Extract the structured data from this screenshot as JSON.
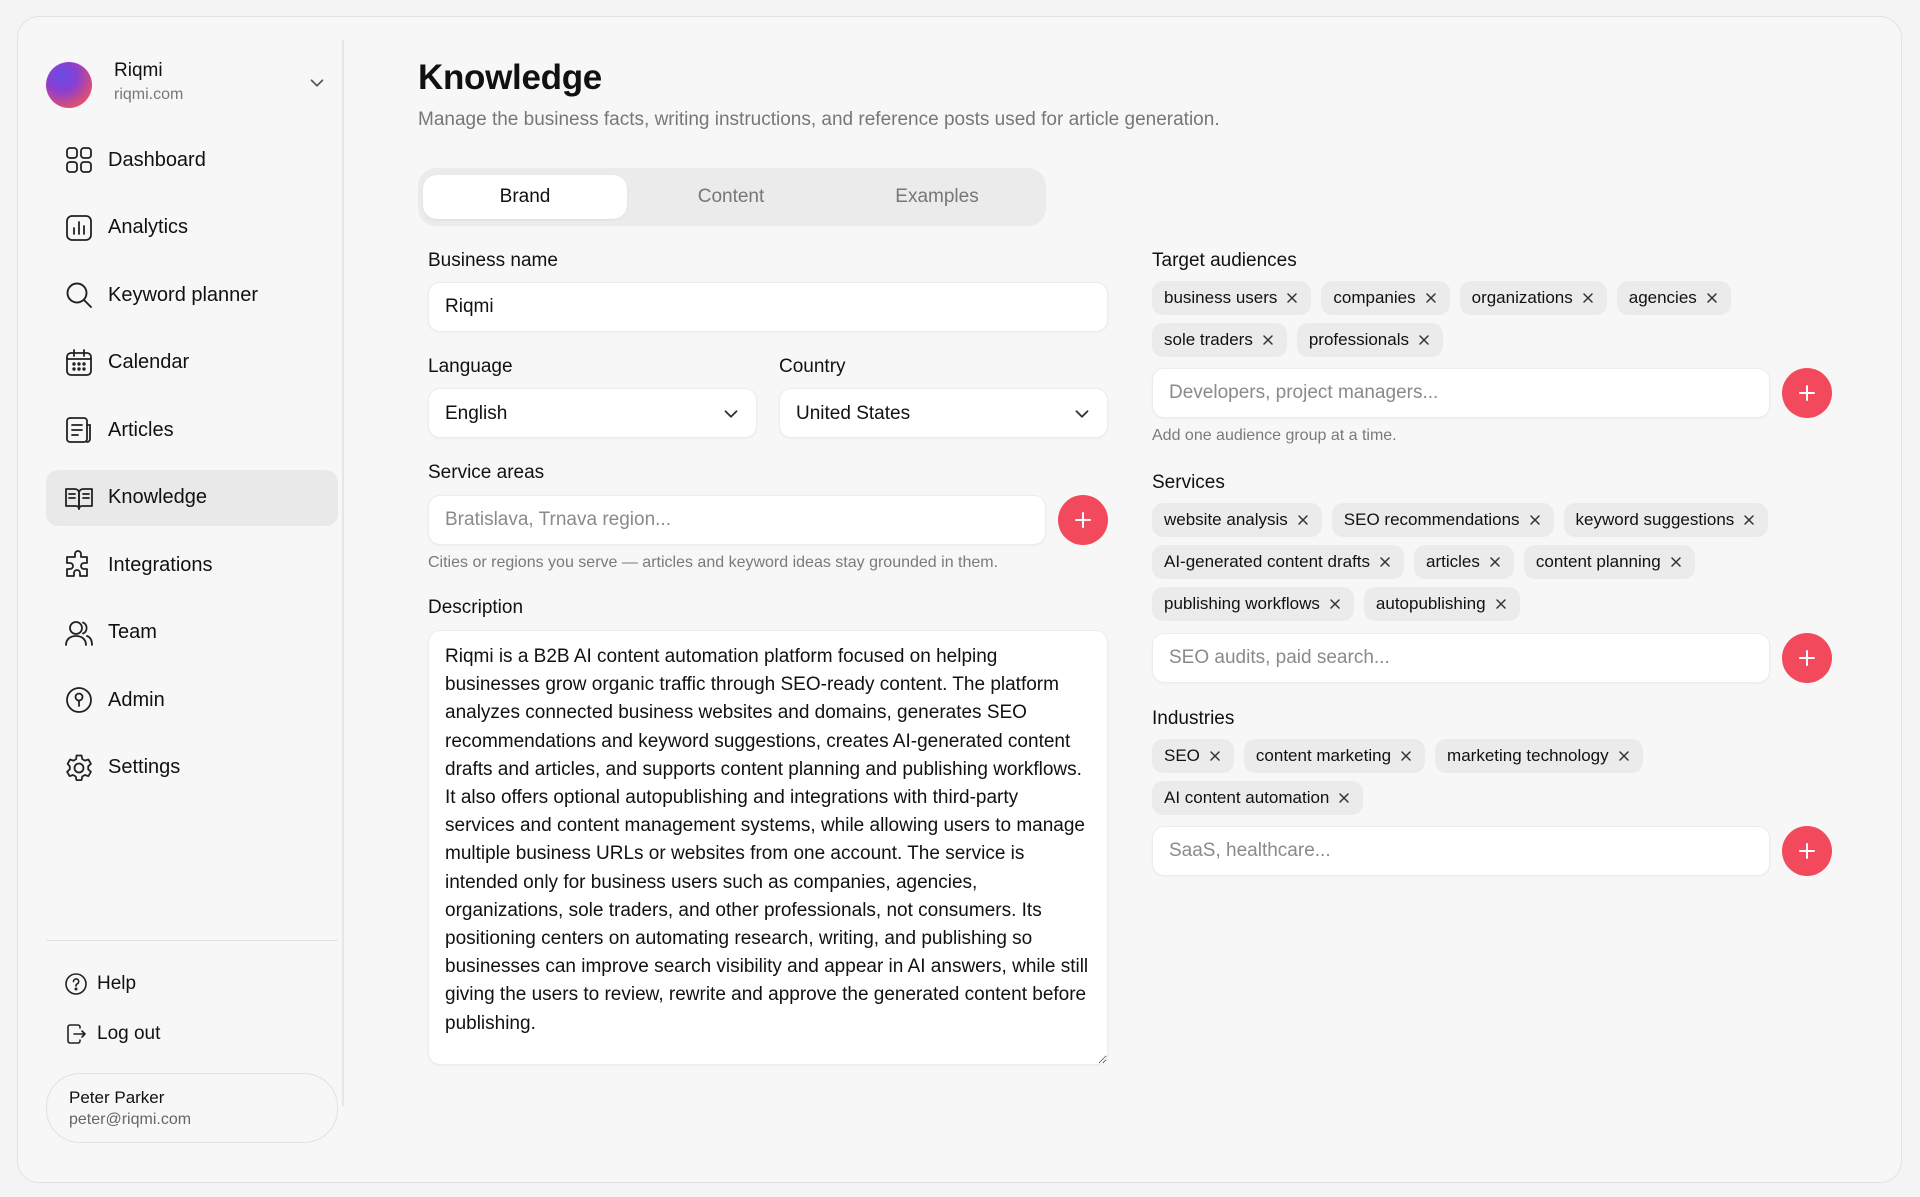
{
  "org": {
    "name": "Riqmi",
    "domain": "riqmi.com"
  },
  "nav": [
    {
      "label": "Dashboard",
      "icon": "dashboard-icon"
    },
    {
      "label": "Analytics",
      "icon": "analytics-icon"
    },
    {
      "label": "Keyword planner",
      "icon": "search-icon"
    },
    {
      "label": "Calendar",
      "icon": "calendar-icon"
    },
    {
      "label": "Articles",
      "icon": "articles-icon"
    },
    {
      "label": "Knowledge",
      "icon": "book-icon",
      "active": true
    },
    {
      "label": "Integrations",
      "icon": "puzzle-icon"
    },
    {
      "label": "Team",
      "icon": "team-icon"
    },
    {
      "label": "Admin",
      "icon": "admin-icon"
    },
    {
      "label": "Settings",
      "icon": "gear-icon"
    }
  ],
  "utility": {
    "help": "Help",
    "logout": "Log out"
  },
  "user": {
    "name": "Peter Parker",
    "email": "peter@riqmi.com"
  },
  "page": {
    "title": "Knowledge",
    "subtitle": "Manage the business facts, writing instructions, and reference posts used for article generation."
  },
  "tabs": [
    {
      "label": "Brand",
      "active": true
    },
    {
      "label": "Content"
    },
    {
      "label": "Examples"
    }
  ],
  "form": {
    "business_name": {
      "label": "Business name",
      "value": "Riqmi"
    },
    "language": {
      "label": "Language",
      "value": "English"
    },
    "country": {
      "label": "Country",
      "value": "United States"
    },
    "service_areas": {
      "label": "Service areas",
      "placeholder": "Bratislava, Trnava region...",
      "hint": "Cities or regions you serve — articles and keyword ideas stay grounded in them."
    },
    "description": {
      "label": "Description",
      "value": "Riqmi is a B2B AI content automation platform focused on helping businesses grow organic traffic through SEO-ready content. The platform analyzes connected business websites and domains, generates SEO recommendations and keyword suggestions, creates AI-generated content drafts and articles, and supports content planning and publishing workflows. It also offers optional autopublishing and integrations with third-party services and content management systems, while allowing users to manage multiple business URLs or websites from one account. The service is intended only for business users such as companies, agencies, organizations, sole traders, and other professionals, not consumers. Its positioning centers on automating research, writing, and publishing so businesses can improve search visibility and appear in AI answers, while still giving the users to review, rewrite and approve the generated content before publishing."
    },
    "target_audiences": {
      "label": "Target audiences",
      "tags": [
        "business users",
        "companies",
        "organizations",
        "agencies",
        "sole traders",
        "professionals"
      ],
      "placeholder": "Developers, project managers...",
      "hint": "Add one audience group at a time."
    },
    "services": {
      "label": "Services",
      "tags": [
        "website analysis",
        "SEO recommendations",
        "keyword suggestions",
        "AI-generated content drafts",
        "articles",
        "content planning",
        "publishing workflows",
        "autopublishing"
      ],
      "placeholder": "SEO audits, paid search..."
    },
    "industries": {
      "label": "Industries",
      "tags": [
        "SEO",
        "content marketing",
        "marketing technology",
        "AI content automation"
      ],
      "placeholder": "SaaS, healthcare..."
    }
  },
  "colors": {
    "accent": "#f24a5c",
    "active_nav_bg": "#e9e9e9",
    "chip_bg": "#ebebeb"
  }
}
